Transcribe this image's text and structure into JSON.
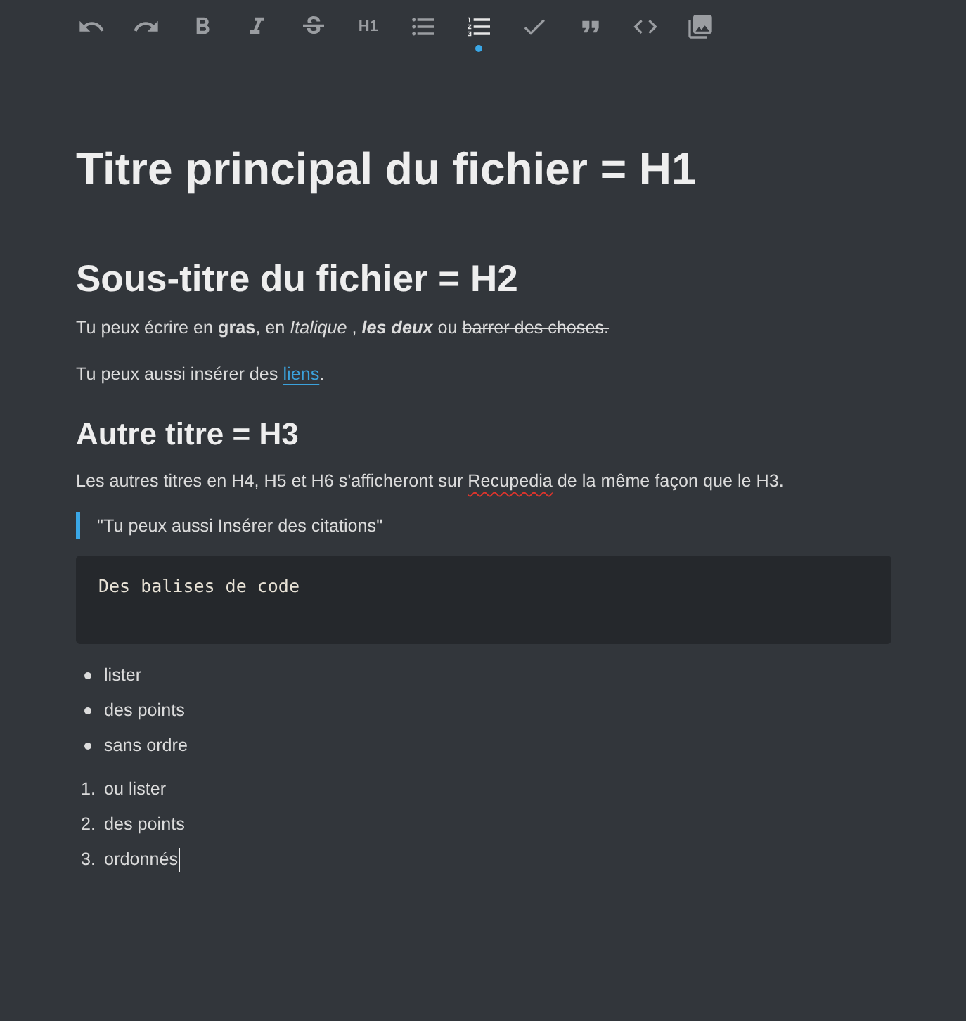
{
  "toolbar": [
    {
      "kind": "undo",
      "active": false
    },
    {
      "kind": "redo",
      "active": false
    },
    {
      "kind": "bold",
      "active": false
    },
    {
      "kind": "italic",
      "active": false
    },
    {
      "kind": "strike",
      "active": false
    },
    {
      "kind": "heading",
      "label": "H1",
      "active": false
    },
    {
      "kind": "bullet-list",
      "active": false
    },
    {
      "kind": "ordered-list",
      "active": true
    },
    {
      "kind": "task",
      "active": false
    },
    {
      "kind": "quote",
      "active": false
    },
    {
      "kind": "code",
      "active": false
    },
    {
      "kind": "image",
      "active": false
    }
  ],
  "document": {
    "blocks": [
      {
        "kind": "h1",
        "text": "Titre principal du fichier = H1"
      },
      {
        "kind": "h2",
        "text": "Sous-titre du fichier = H2"
      },
      {
        "kind": "paragraph",
        "segments": [
          {
            "kind": "plain",
            "text": "Tu peux écrire en "
          },
          {
            "kind": "bold",
            "text": "gras"
          },
          {
            "kind": "plain",
            "text": ", en "
          },
          {
            "kind": "italic",
            "text": "Italique"
          },
          {
            "kind": "plain",
            "text": " , "
          },
          {
            "kind": "bold-italic",
            "text": "les deux"
          },
          {
            "kind": "plain",
            "text": " ou "
          },
          {
            "kind": "strike",
            "text": "barrer des choses."
          }
        ]
      },
      {
        "kind": "paragraph",
        "segments": [
          {
            "kind": "plain",
            "text": "Tu peux aussi insérer des "
          },
          {
            "kind": "link",
            "text": "liens"
          },
          {
            "kind": "plain",
            "text": "."
          }
        ]
      },
      {
        "kind": "h3",
        "text": "Autre titre = H3"
      },
      {
        "kind": "paragraph",
        "segments": [
          {
            "kind": "plain",
            "text": "Les autres titres en H4, H5 et H6 s'afficheront sur "
          },
          {
            "kind": "misspelled",
            "text": "Recupedia"
          },
          {
            "kind": "plain",
            "text": " de la même façon que le H3."
          }
        ]
      },
      {
        "kind": "quote",
        "text": "\"Tu peux aussi Insérer des citations\""
      },
      {
        "kind": "code",
        "text": "Des balises de code"
      },
      {
        "kind": "bullet-list",
        "items": [
          {
            "text": "lister",
            "cursor": false
          },
          {
            "text": "des points",
            "cursor": false
          },
          {
            "text": "sans ordre",
            "cursor": false
          }
        ]
      },
      {
        "kind": "ordered-list",
        "items": [
          {
            "marker": "1.",
            "text": "ou lister",
            "cursor": false
          },
          {
            "marker": "2.",
            "text": "des points",
            "cursor": false
          },
          {
            "marker": "3.",
            "text": "ordonnés",
            "cursor": true
          }
        ]
      }
    ]
  }
}
